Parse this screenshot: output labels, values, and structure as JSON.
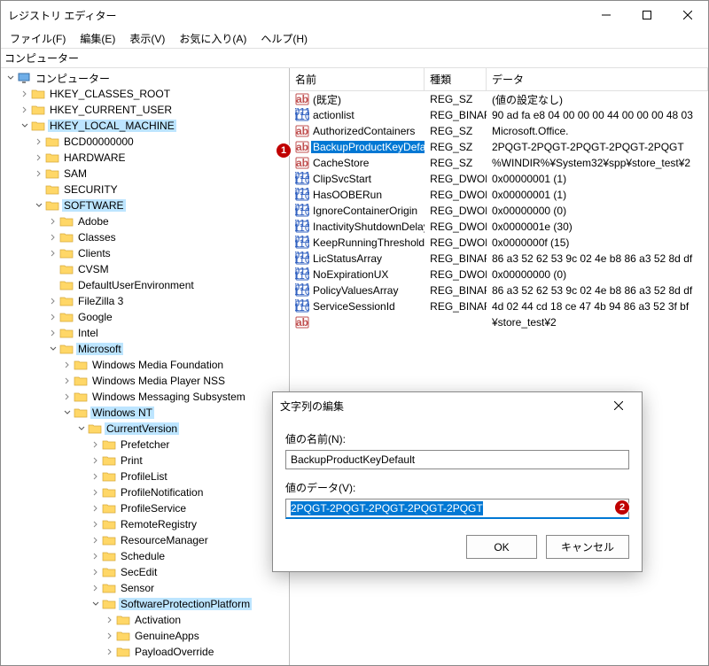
{
  "window": {
    "title": "レジストリ エディター"
  },
  "menu": {
    "file": "ファイル(F)",
    "edit": "編集(E)",
    "view": "表示(V)",
    "fav": "お気に入り(A)",
    "help": "ヘルプ(H)"
  },
  "address": "コンピューター",
  "columns": {
    "name": "名前",
    "type": "種類",
    "data": "データ"
  },
  "tree": [
    {
      "d": 0,
      "exp": "open",
      "icon": "pc",
      "label": "コンピューター",
      "hl": false
    },
    {
      "d": 1,
      "exp": "closed",
      "icon": "f",
      "label": "HKEY_CLASSES_ROOT",
      "hl": false
    },
    {
      "d": 1,
      "exp": "closed",
      "icon": "f",
      "label": "HKEY_CURRENT_USER",
      "hl": false
    },
    {
      "d": 1,
      "exp": "open",
      "icon": "f",
      "label": "HKEY_LOCAL_MACHINE",
      "hl": true
    },
    {
      "d": 2,
      "exp": "closed",
      "icon": "f",
      "label": "BCD00000000",
      "hl": false
    },
    {
      "d": 2,
      "exp": "closed",
      "icon": "f",
      "label": "HARDWARE",
      "hl": false
    },
    {
      "d": 2,
      "exp": "closed",
      "icon": "f",
      "label": "SAM",
      "hl": false
    },
    {
      "d": 2,
      "exp": "none",
      "icon": "f",
      "label": "SECURITY",
      "hl": false
    },
    {
      "d": 2,
      "exp": "open",
      "icon": "f",
      "label": "SOFTWARE",
      "hl": true
    },
    {
      "d": 3,
      "exp": "closed",
      "icon": "f",
      "label": "Adobe",
      "hl": false
    },
    {
      "d": 3,
      "exp": "closed",
      "icon": "f",
      "label": "Classes",
      "hl": false
    },
    {
      "d": 3,
      "exp": "closed",
      "icon": "f",
      "label": "Clients",
      "hl": false
    },
    {
      "d": 3,
      "exp": "none",
      "icon": "f",
      "label": "CVSM",
      "hl": false
    },
    {
      "d": 3,
      "exp": "none",
      "icon": "f",
      "label": "DefaultUserEnvironment",
      "hl": false
    },
    {
      "d": 3,
      "exp": "closed",
      "icon": "f",
      "label": "FileZilla 3",
      "hl": false
    },
    {
      "d": 3,
      "exp": "closed",
      "icon": "f",
      "label": "Google",
      "hl": false
    },
    {
      "d": 3,
      "exp": "closed",
      "icon": "f",
      "label": "Intel",
      "hl": false
    },
    {
      "d": 3,
      "exp": "open",
      "icon": "f",
      "label": "Microsoft",
      "hl": true
    },
    {
      "d": 4,
      "exp": "closed",
      "icon": "f",
      "label": "Windows Media Foundation",
      "hl": false
    },
    {
      "d": 4,
      "exp": "closed",
      "icon": "f",
      "label": "Windows Media Player NSS",
      "hl": false
    },
    {
      "d": 4,
      "exp": "closed",
      "icon": "f",
      "label": "Windows Messaging Subsystem",
      "hl": false
    },
    {
      "d": 4,
      "exp": "open",
      "icon": "f",
      "label": "Windows NT",
      "hl": true
    },
    {
      "d": 5,
      "exp": "open",
      "icon": "f",
      "label": "CurrentVersion",
      "hl": true
    },
    {
      "d": 6,
      "exp": "closed",
      "icon": "f",
      "label": "Prefetcher",
      "hl": false
    },
    {
      "d": 6,
      "exp": "closed",
      "icon": "f",
      "label": "Print",
      "hl": false
    },
    {
      "d": 6,
      "exp": "closed",
      "icon": "f",
      "label": "ProfileList",
      "hl": false
    },
    {
      "d": 6,
      "exp": "closed",
      "icon": "f",
      "label": "ProfileNotification",
      "hl": false
    },
    {
      "d": 6,
      "exp": "closed",
      "icon": "f",
      "label": "ProfileService",
      "hl": false
    },
    {
      "d": 6,
      "exp": "closed",
      "icon": "f",
      "label": "RemoteRegistry",
      "hl": false
    },
    {
      "d": 6,
      "exp": "closed",
      "icon": "f",
      "label": "ResourceManager",
      "hl": false
    },
    {
      "d": 6,
      "exp": "closed",
      "icon": "f",
      "label": "Schedule",
      "hl": false
    },
    {
      "d": 6,
      "exp": "closed",
      "icon": "f",
      "label": "SecEdit",
      "hl": false
    },
    {
      "d": 6,
      "exp": "closed",
      "icon": "f",
      "label": "Sensor",
      "hl": false
    },
    {
      "d": 6,
      "exp": "open",
      "icon": "f",
      "label": "SoftwareProtectionPlatform",
      "hl": true
    },
    {
      "d": 7,
      "exp": "closed",
      "icon": "f",
      "label": "Activation",
      "hl": false
    },
    {
      "d": 7,
      "exp": "closed",
      "icon": "f",
      "label": "GenuineApps",
      "hl": false
    },
    {
      "d": 7,
      "exp": "closed",
      "icon": "f",
      "label": "PayloadOverride",
      "hl": false
    }
  ],
  "values": [
    {
      "icon": "sz",
      "name": "(既定)",
      "type": "REG_SZ",
      "data": "(値の設定なし)",
      "sel": false
    },
    {
      "icon": "bin",
      "name": "actionlist",
      "type": "REG_BINARY",
      "data": "90 ad fa e8 04 00 00 00 44 00 00 00 48 03",
      "sel": false
    },
    {
      "icon": "sz",
      "name": "AuthorizedContainers",
      "type": "REG_SZ",
      "data": "Microsoft.Office.",
      "sel": false
    },
    {
      "icon": "sz",
      "name": "BackupProductKeyDefault",
      "type": "REG_SZ",
      "data": "2PQGT-2PQGT-2PQGT-2PQGT-2PQGT",
      "sel": true
    },
    {
      "icon": "sz",
      "name": "CacheStore",
      "type": "REG_SZ",
      "data": "%WINDIR%¥System32¥spp¥store_test¥2",
      "sel": false
    },
    {
      "icon": "bin",
      "name": "ClipSvcStart",
      "type": "REG_DWORD",
      "data": "0x00000001 (1)",
      "sel": false
    },
    {
      "icon": "bin",
      "name": "HasOOBERun",
      "type": "REG_DWORD",
      "data": "0x00000001 (1)",
      "sel": false
    },
    {
      "icon": "bin",
      "name": "IgnoreContainerOrigin",
      "type": "REG_DWORD",
      "data": "0x00000000 (0)",
      "sel": false
    },
    {
      "icon": "bin",
      "name": "InactivityShutdownDelay",
      "type": "REG_DWORD",
      "data": "0x0000001e (30)",
      "sel": false
    },
    {
      "icon": "bin",
      "name": "KeepRunningThresholdMins",
      "type": "REG_DWORD",
      "data": "0x0000000f (15)",
      "sel": false
    },
    {
      "icon": "bin",
      "name": "LicStatusArray",
      "type": "REG_BINARY",
      "data": "86 a3 52 62 53 9c 02 4e b8 86 a3 52 8d df",
      "sel": false
    },
    {
      "icon": "bin",
      "name": "NoExpirationUX",
      "type": "REG_DWORD",
      "data": "0x00000000 (0)",
      "sel": false
    },
    {
      "icon": "bin",
      "name": "PolicyValuesArray",
      "type": "REG_BINARY",
      "data": "86 a3 52 62 53 9c 02 4e b8 86 a3 52 8d df",
      "sel": false
    },
    {
      "icon": "bin",
      "name": "ServiceSessionId",
      "type": "REG_BINARY",
      "data": "4d 02 44 cd 18 ce 47 4b 94 86 a3 52 3f bf",
      "sel": false
    },
    {
      "icon": "sz",
      "name": "",
      "type": "",
      "data": "¥store_test¥2",
      "sel": false
    }
  ],
  "dialog": {
    "title": "文字列の編集",
    "name_label": "値の名前(N):",
    "name_value": "BackupProductKeyDefault",
    "data_label": "値のデータ(V):",
    "data_value": "2PQGT-2PQGT-2PQGT-2PQGT-2PQGT",
    "ok": "OK",
    "cancel": "キャンセル"
  },
  "badges": {
    "b1": "1",
    "b2": "2"
  }
}
